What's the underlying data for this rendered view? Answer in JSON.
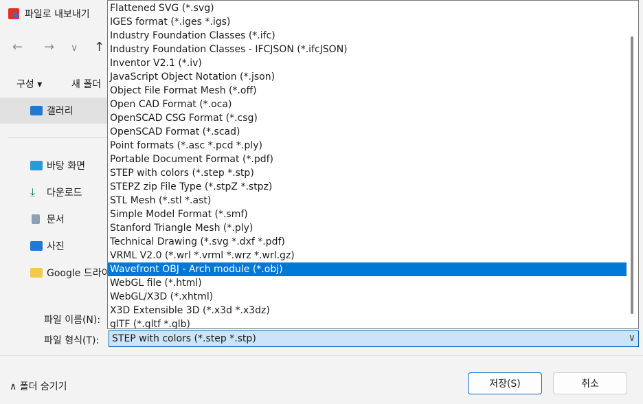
{
  "window": {
    "title": "파일로 내보내기"
  },
  "nav": {
    "back": "←",
    "forward": "→",
    "recent": "∨",
    "up": "↑"
  },
  "toolbar": {
    "organize": "구성 ▾",
    "new_folder": "새 폴더"
  },
  "sidebar": {
    "items": [
      {
        "label": "갤러리",
        "icon": "gallery-icon",
        "selected": true
      },
      {
        "label": "바탕 화면",
        "icon": "desktop-icon"
      },
      {
        "label": "다운로드",
        "icon": "download-icon"
      },
      {
        "label": "문서",
        "icon": "documents-icon"
      },
      {
        "label": "사진",
        "icon": "pictures-icon"
      },
      {
        "label": "Google 드라이브",
        "icon": "folder-icon"
      }
    ]
  },
  "form": {
    "filename_label": "파일 이름(N):",
    "filetype_label": "파일 형식(T):",
    "filetype_value": "STEP with colors (*.step *.stp)"
  },
  "filetype_options": [
    {
      "label": "Flattened SVG (*.svg)"
    },
    {
      "label": "IGES format (*.iges *.igs)"
    },
    {
      "label": "Industry Foundation Classes (*.ifc)"
    },
    {
      "label": "Industry Foundation Classes - IFCJSON (*.ifcJSON)"
    },
    {
      "label": "Inventor V2.1 (*.iv)"
    },
    {
      "label": "JavaScript Object Notation (*.json)"
    },
    {
      "label": "Object File Format Mesh (*.off)"
    },
    {
      "label": "Open CAD Format (*.oca)"
    },
    {
      "label": "OpenSCAD CSG Format (*.csg)"
    },
    {
      "label": "OpenSCAD Format (*.scad)"
    },
    {
      "label": "Point formats (*.asc *.pcd *.ply)"
    },
    {
      "label": "Portable Document Format (*.pdf)"
    },
    {
      "label": "STEP with colors (*.step *.stp)"
    },
    {
      "label": "STEPZ zip File Type (*.stpZ *.stpz)"
    },
    {
      "label": "STL Mesh (*.stl *.ast)"
    },
    {
      "label": "Simple Model Format (*.smf)"
    },
    {
      "label": "Stanford Triangle Mesh (*.ply)"
    },
    {
      "label": "Technical Drawing (*.svg *.dxf *.pdf)"
    },
    {
      "label": "VRML V2.0 (*.wrl *.vrml *.wrz *.wrl.gz)"
    },
    {
      "label": "Wavefront OBJ - Arch module (*.obj)",
      "selected": true
    },
    {
      "label": "WebGL file (*.html)"
    },
    {
      "label": "WebGL/X3D (*.xhtml)"
    },
    {
      "label": "X3D Extensible 3D (*.x3d *.x3dz)"
    },
    {
      "label": "glTF (*.gltf *.glb)"
    }
  ],
  "footer": {
    "hide_folders": "∧  폴더 숨기기",
    "save": "저장(S)",
    "cancel": "취소"
  }
}
